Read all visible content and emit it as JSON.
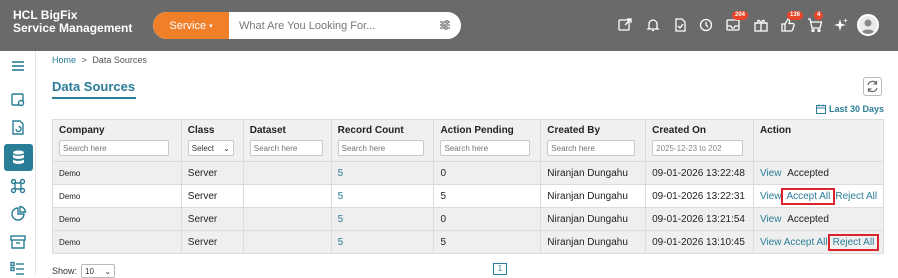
{
  "header": {
    "brand_line1": "HCL BigFix",
    "brand_line2": "Service Management",
    "service_button": "Service",
    "search_placeholder": "What Are You Looking For...",
    "badges": {
      "b1": "204",
      "b2": "136",
      "b3": "4"
    }
  },
  "breadcrumb": {
    "home": "Home",
    "sep": ">",
    "current": "Data Sources"
  },
  "page": {
    "title": "Data Sources",
    "date_range": "Last 30 Days"
  },
  "table": {
    "headers": [
      "Company",
      "Class",
      "Dataset",
      "Record Count",
      "Action Pending",
      "Created By",
      "Created On",
      "Action"
    ],
    "filters": {
      "company": "Search here",
      "class": "Select",
      "dataset": "Search here",
      "record_count": "Search here",
      "action_pending": "Search here",
      "created_by": "Search here",
      "created_on": "2025-12-23 to 202"
    },
    "rows": [
      {
        "company": "Demo",
        "class": "Server",
        "dataset": "",
        "record_count": "5",
        "action_pending": "0",
        "created_by": "Niranjan Dungahu",
        "created_on": "09-01-2026 13:22:48",
        "view": "View",
        "a2": "Accepted",
        "a3": ""
      },
      {
        "company": "Demo",
        "class": "Server",
        "dataset": "",
        "record_count": "5",
        "action_pending": "5",
        "created_by": "Niranjan Dungahu",
        "created_on": "09-01-2026 13:22:31",
        "view": "View",
        "a2": "Accept All",
        "a3": "Reject All"
      },
      {
        "company": "Demo",
        "class": "Server",
        "dataset": "",
        "record_count": "5",
        "action_pending": "0",
        "created_by": "Niranjan Dungahu",
        "created_on": "09-01-2026 13:21:54",
        "view": "View",
        "a2": "Accepted",
        "a3": ""
      },
      {
        "company": "Demo",
        "class": "Server",
        "dataset": "",
        "record_count": "5",
        "action_pending": "5",
        "created_by": "Niranjan Dungahu",
        "created_on": "09-01-2026 13:10:45",
        "view": "View",
        "a2": "Accept All",
        "a3": "Reject All"
      }
    ]
  },
  "footer": {
    "show_label": "Show:",
    "page_size": "10",
    "page_number": "1"
  },
  "colors": {
    "accent": "#2a7d96",
    "service": "#f07f2a",
    "highlight": "#d9232d",
    "topbar": "#6a6a6a"
  }
}
